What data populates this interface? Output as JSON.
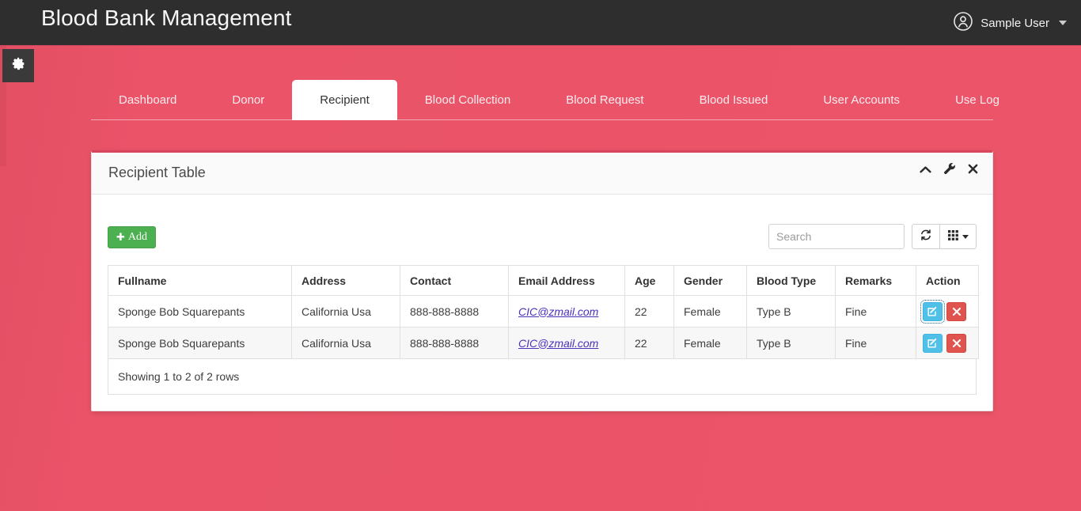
{
  "theme": {
    "page_bg": "#ea5368",
    "navbar_bg": "#2e2e2e",
    "panel_accent": "#d9455c",
    "add_button_bg": "#4cb050",
    "edit_button_bg": "#50c0e8",
    "delete_button_bg": "#e0544f",
    "link_color": "#4b2fbd"
  },
  "navbar": {
    "brand": "Blood Bank Management",
    "user_name": "Sample User",
    "user_icon": "user-circle-icon",
    "caret_icon": "chevron-down-icon",
    "gear_icon": "gear-icon"
  },
  "tabs": [
    {
      "label": "Dashboard",
      "active": false
    },
    {
      "label": "Donor",
      "active": false
    },
    {
      "label": "Recipient",
      "active": true
    },
    {
      "label": "Blood Collection",
      "active": false
    },
    {
      "label": "Blood Request",
      "active": false
    },
    {
      "label": "Blood Issued",
      "active": false
    },
    {
      "label": "User Accounts",
      "active": false
    },
    {
      "label": "Use Log",
      "active": false
    }
  ],
  "panel": {
    "title": "Recipient Table",
    "tools": [
      {
        "name": "collapse-icon",
        "glyph": "chevron-up-icon"
      },
      {
        "name": "settings-icon",
        "glyph": "wrench-icon"
      },
      {
        "name": "close-icon",
        "glyph": "times-icon"
      }
    ]
  },
  "toolbar": {
    "add_label": "Add",
    "add_icon": "plus-icon",
    "search_placeholder": "Search",
    "search_value": "",
    "refresh_icon": "refresh-icon",
    "columns_icon": "grid-columns-icon"
  },
  "table": {
    "columns": [
      "Fullname",
      "Address",
      "Contact",
      "Email Address",
      "Age",
      "Gender",
      "Blood Type",
      "Remarks",
      "Action"
    ],
    "rows": [
      {
        "fullname": "Sponge Bob Squarepants",
        "address": "California Usa",
        "contact": "888-888-8888",
        "email": "CIC@zmail.com",
        "age": "22",
        "gender": "Female",
        "blood_type": "Type B",
        "remarks": "Fine",
        "striped": false,
        "edit_focused": true
      },
      {
        "fullname": "Sponge Bob Squarepants",
        "address": "California Usa",
        "contact": "888-888-8888",
        "email": "CIC@zmail.com",
        "age": "22",
        "gender": "Female",
        "blood_type": "Type B",
        "remarks": "Fine",
        "striped": true,
        "edit_focused": false
      }
    ],
    "footer": "Showing 1 to 2 of 2 rows",
    "action_icons": {
      "edit": "pencil-square-icon",
      "delete": "times-icon"
    }
  }
}
